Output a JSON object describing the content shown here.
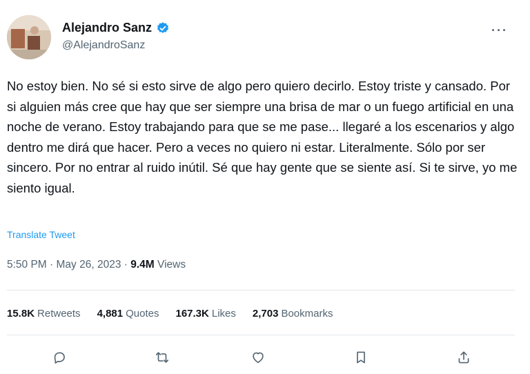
{
  "author": {
    "display_name": "Alejandro Sanz",
    "handle": "@AlejandroSanz",
    "verified": true,
    "verified_color": "#1d9bf0"
  },
  "tweet": {
    "text": "No estoy bien. No sé si esto sirve de algo pero quiero decirlo. Estoy triste y cansado. Por si alguien más cree que hay que ser siempre una brisa de mar o un fuego artificial en una noche de verano. Estoy trabajando para que se me pase... llegaré a los escenarios y algo dentro me dirá que hacer. Pero a veces no quiero ni estar. Literalmente. Sólo por ser sincero. Por no entrar al ruido inútil. Sé que hay gente que se siente así. Si te sirve, yo me siento igual.",
    "translate_label": "Translate Tweet",
    "time": "5:50 PM",
    "date": "May 26, 2023",
    "views_count": "9.4M",
    "views_label": "Views"
  },
  "stats": {
    "retweets": {
      "count": "15.8K",
      "label": "Retweets"
    },
    "quotes": {
      "count": "4,881",
      "label": "Quotes"
    },
    "likes": {
      "count": "167.3K",
      "label": "Likes"
    },
    "bookmarks": {
      "count": "2,703",
      "label": "Bookmarks"
    }
  },
  "icons": {
    "more": "more-icon",
    "reply": "reply-icon",
    "retweet": "retweet-icon",
    "like": "like-icon",
    "bookmark": "bookmark-icon",
    "share": "share-icon"
  }
}
